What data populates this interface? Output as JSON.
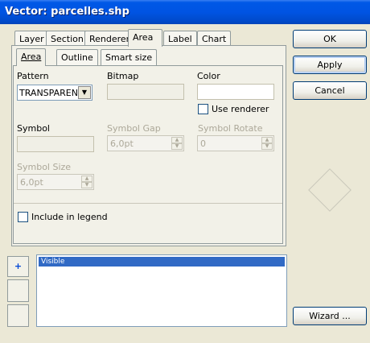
{
  "window": {
    "title": "Vector: parcelles.shp"
  },
  "tabs": [
    "Layer",
    "Section",
    "Renderer",
    "Area",
    "Label",
    "Chart"
  ],
  "subtabs": [
    "Area",
    "Outline",
    "Smart size"
  ],
  "area": {
    "pattern_label": "Pattern",
    "pattern_value": "TRANSPAREN",
    "bitmap_label": "Bitmap",
    "color_label": "Color",
    "use_renderer_label": "Use renderer",
    "symbol_label": "Symbol",
    "symbol_gap_label": "Symbol Gap",
    "symbol_gap_value": "6,0pt",
    "symbol_rotate_label": "Symbol Rotate",
    "symbol_rotate_value": "0",
    "symbol_size_label": "Symbol Size",
    "symbol_size_value": "6,0pt",
    "include_legend_label": "Include in legend"
  },
  "buttons": {
    "ok": "OK",
    "apply": "Apply",
    "cancel": "Cancel",
    "wizard": "Wizard ..."
  },
  "side_buttons": {
    "add": "+"
  },
  "list": {
    "items": [
      "Visible"
    ]
  }
}
